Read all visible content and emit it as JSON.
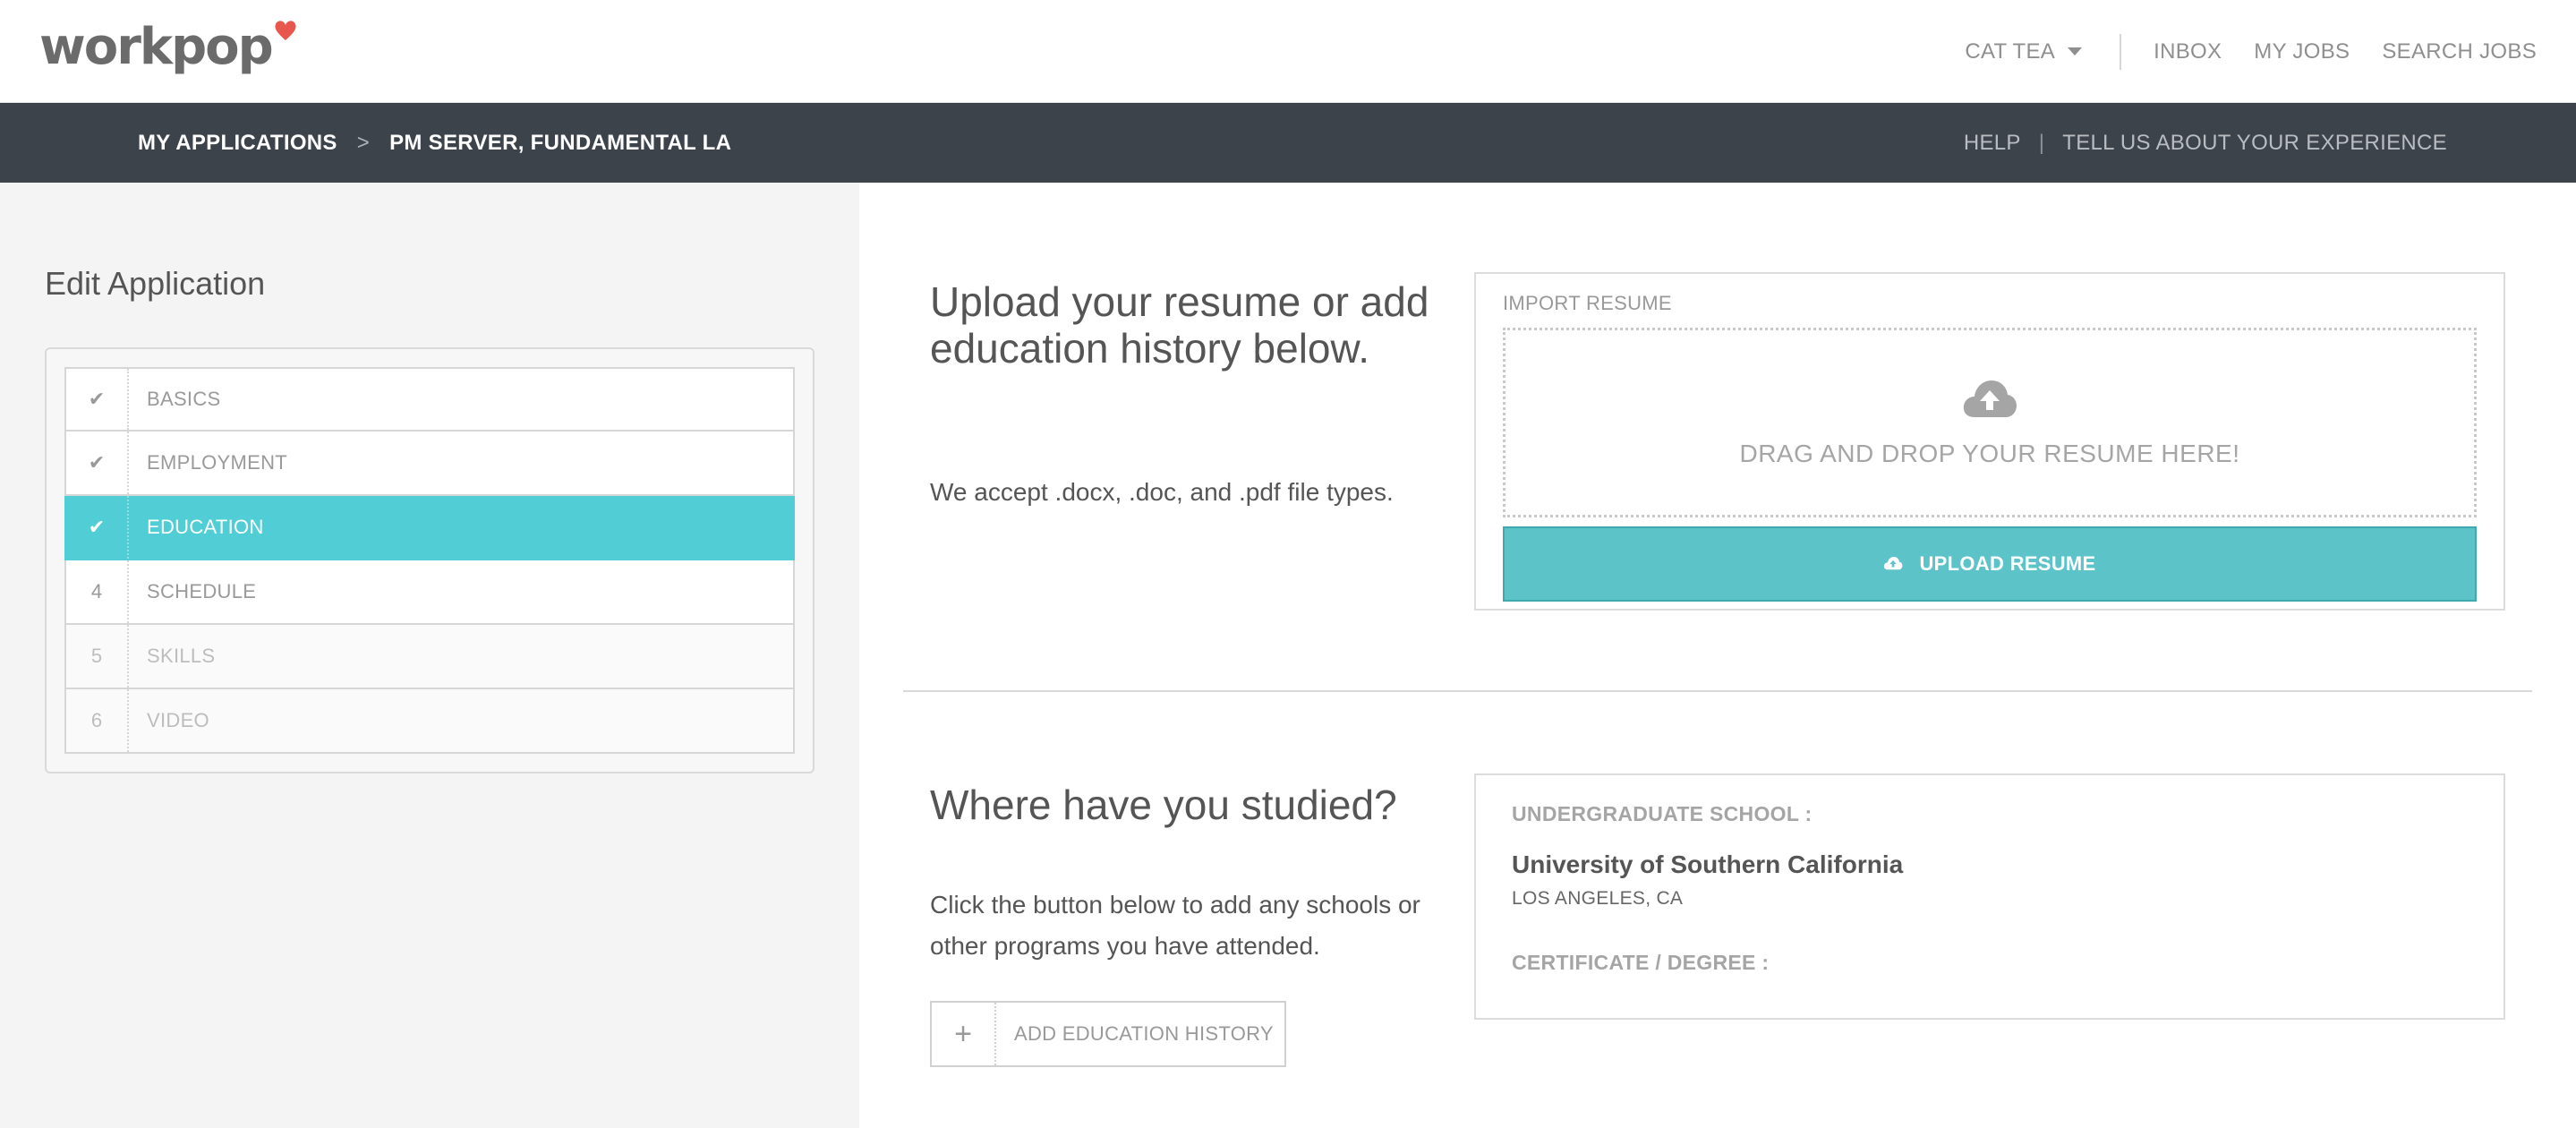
{
  "header": {
    "logo_text": "workpop",
    "user_name": "CAT TEA",
    "nav": [
      "INBOX",
      "MY JOBS",
      "SEARCH JOBS"
    ]
  },
  "breadcrumb": {
    "root": "MY APPLICATIONS",
    "separator": ">",
    "current": "PM SERVER,  FUNDAMENTAL LA",
    "help": "HELP",
    "pipe": "|",
    "feedback": "TELL US ABOUT YOUR EXPERIENCE"
  },
  "sidebar": {
    "title": "Edit Application",
    "steps": [
      {
        "marker": "✔",
        "label": "BASICS",
        "state": "complete"
      },
      {
        "marker": "✔",
        "label": "EMPLOYMENT",
        "state": "complete"
      },
      {
        "marker": "✔",
        "label": "EDUCATION",
        "state": "active"
      },
      {
        "marker": "4",
        "label": "SCHEDULE",
        "state": "pending"
      },
      {
        "marker": "5",
        "label": "SKILLS",
        "state": "disabled"
      },
      {
        "marker": "6",
        "label": "VIDEO",
        "state": "disabled"
      }
    ]
  },
  "upload": {
    "heading": "Upload your resume or add education history below.",
    "subtext": "We accept .docx, .doc, and .pdf file types.",
    "import_label": "IMPORT RESUME",
    "dropzone_text": "DRAG AND DROP YOUR RESUME HERE!",
    "button_label": "UPLOAD RESUME"
  },
  "education": {
    "heading": "Where have you studied?",
    "subtext": "Click the button below to add any schools or other programs you have attended.",
    "add_button_icon": "+",
    "add_button_label": "ADD EDUCATION HISTORY",
    "school_label": "UNDERGRADUATE SCHOOL :",
    "school_name": "University of Southern California",
    "school_location": "LOS ANGELES, CA",
    "degree_label": "CERTIFICATE / DEGREE :"
  },
  "colors": {
    "accent": "#50cdd5",
    "upload_button": "#5cc3c9",
    "dark_bar": "#3d434b",
    "logo_heart": "#e8574d"
  }
}
